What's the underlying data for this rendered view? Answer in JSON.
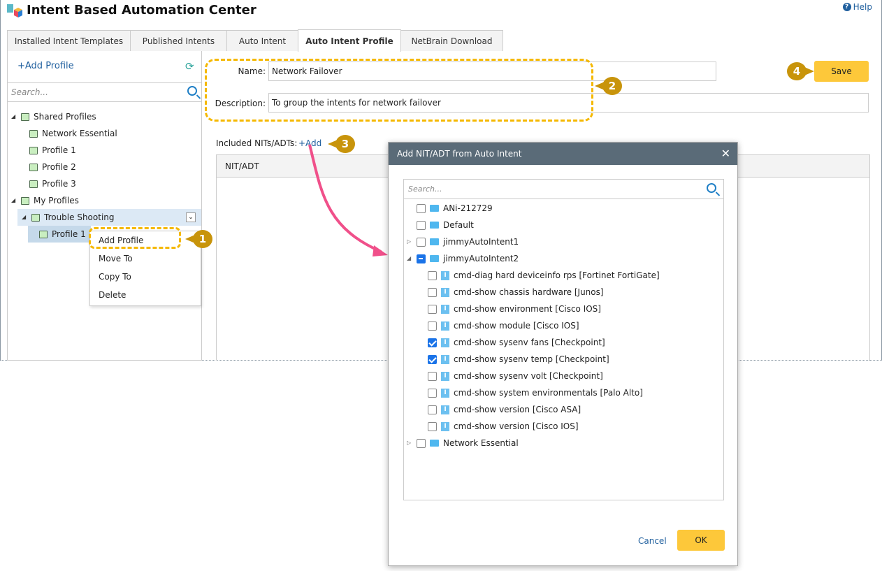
{
  "app": {
    "title": "Intent Based Automation Center",
    "help": "Help"
  },
  "tabs": [
    "Installed Intent Templates",
    "Published Intents",
    "Auto Intent",
    "Auto Intent Profile",
    "NetBrain Download"
  ],
  "left": {
    "add_profile": "+Add Profile",
    "search_placeholder": "Search...",
    "tree": {
      "shared": "Shared Profiles",
      "shared_items": [
        "Network Essential",
        "Profile 1",
        "Profile 2",
        "Profile 3"
      ],
      "my": "My Profiles",
      "folder": "Trouble Shooting",
      "child": "Profile 1"
    },
    "context_menu": [
      "Add Profile",
      "Move To",
      "Copy To",
      "Delete"
    ]
  },
  "form": {
    "name_label": "Name:",
    "name_value": "Network Failover",
    "desc_label": "Description:",
    "desc_value": "To group the intents for network failover",
    "included_label": "Included NITs/ADTs:",
    "add_link": "+Add",
    "save": "Save",
    "grid_header": "NIT/ADT"
  },
  "callouts": [
    "1",
    "2",
    "3",
    "4"
  ],
  "dialog": {
    "title": "Add NIT/ADT from Auto Intent",
    "search_placeholder": "Search...",
    "folders_top": [
      {
        "label": "ANi-212729",
        "expander": "none",
        "check": "off"
      },
      {
        "label": "Default",
        "expander": "none",
        "check": "off"
      },
      {
        "label": "jimmyAutoIntent1",
        "expander": "collapsed",
        "check": "off"
      },
      {
        "label": "jimmyAutoIntent2",
        "expander": "expanded",
        "check": "partial"
      }
    ],
    "items": [
      {
        "label": "cmd-diag hard deviceinfo rps [Fortinet FortiGate]",
        "check": "off"
      },
      {
        "label": "cmd-show chassis hardware [Junos]",
        "check": "off"
      },
      {
        "label": "cmd-show environment [Cisco IOS]",
        "check": "off"
      },
      {
        "label": "cmd-show module [Cisco IOS]",
        "check": "off"
      },
      {
        "label": "cmd-show sysenv fans [Checkpoint]",
        "check": "on"
      },
      {
        "label": "cmd-show sysenv temp [Checkpoint]",
        "check": "on"
      },
      {
        "label": "cmd-show sysenv volt [Checkpoint]",
        "check": "off"
      },
      {
        "label": "cmd-show system environmentals [Palo Alto]",
        "check": "off"
      },
      {
        "label": "cmd-show version [Cisco ASA]",
        "check": "off"
      },
      {
        "label": "cmd-show version [Cisco IOS]",
        "check": "off"
      }
    ],
    "folder_last": {
      "label": "Network Essential",
      "expander": "collapsed",
      "check": "off"
    },
    "cancel": "Cancel",
    "ok": "OK"
  },
  "colors": {
    "accent": "#fdc83a",
    "callout": "#c8940b",
    "link": "#1f5f9e",
    "dialog_header": "#5a6b78",
    "arrow": "#f0508a"
  }
}
